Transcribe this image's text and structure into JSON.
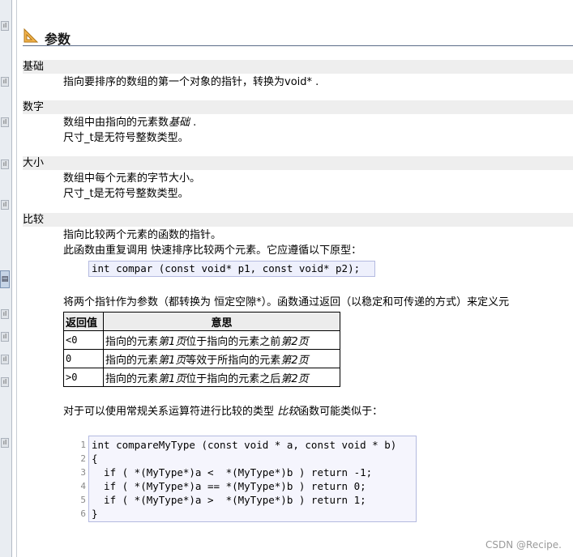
{
  "section_heading": "参数",
  "params": [
    {
      "term": "基础",
      "lines": [
        "指向要排序的数组的第一个对象的指针，转换为void* ."
      ]
    },
    {
      "term": "数字",
      "lines": [
        "数组中由指向的元素数",
        "尺寸_t是无符号整数类型。"
      ],
      "italic_ref": "基础",
      "after_ref": " ."
    },
    {
      "term": "大小",
      "lines": [
        "数组中每个元素的字节大小。",
        "尺寸_t是无符号整数类型。"
      ]
    },
    {
      "term": "比较",
      "lines": [
        "指向比较两个元素的函数的指针。",
        "此函数由重复调用  快速排序比较两个元素。它应遵循以下原型："
      ]
    }
  ],
  "prototype": "int compar (const void* p1, const void* p2);",
  "explain_text": "将两个指针作为参数（都转换为  恒定空隙*）。函数通过返回（以稳定和可传递的方式）来定义元",
  "return_table": {
    "headers": [
      "返回值",
      "意思"
    ],
    "rows": [
      {
        "value": "<0",
        "pre": "指向的元素",
        "ref1": "第1页",
        "mid": "位于指向的元素之前",
        "ref2": "第2页"
      },
      {
        "value": "0",
        "pre": "指向的元素",
        "ref1": "第1页",
        "mid": "等效于所指向的元素",
        "ref2": "第2页"
      },
      {
        "value": ">0",
        "pre": "指向的元素",
        "ref1": "第1页",
        "mid": "位于指向的元素之后",
        "ref2": "第2页"
      }
    ]
  },
  "compare_text_pre": "对于可以使用常规关系运算符进行比较的类型  ",
  "compare_text_ref": "比较",
  "compare_text_post": "函数可能类似于：",
  "code": {
    "line_numbers": [
      "1",
      "2",
      "3",
      "4",
      "5",
      "6"
    ],
    "lines": [
      "int compareMyType (const void * a, const void * b)",
      "{",
      "  if ( *(MyType*)a <  *(MyType*)b ) return -1;",
      "  if ( *(MyType*)a == *(MyType*)b ) return 0;",
      "  if ( *(MyType*)a >  *(MyType*)b ) return 1;",
      "}"
    ]
  },
  "watermark": "CSDN @Recipe.",
  "icons": {
    "heading": "ruler-triangle-icon",
    "strip_button": "panel-toggle-icon"
  },
  "colors": {
    "term_bg": "#eeeeee",
    "code_bg": "#f5f5fd",
    "code_border": "#b4bae0",
    "heading_rule": "#5b6b88"
  }
}
